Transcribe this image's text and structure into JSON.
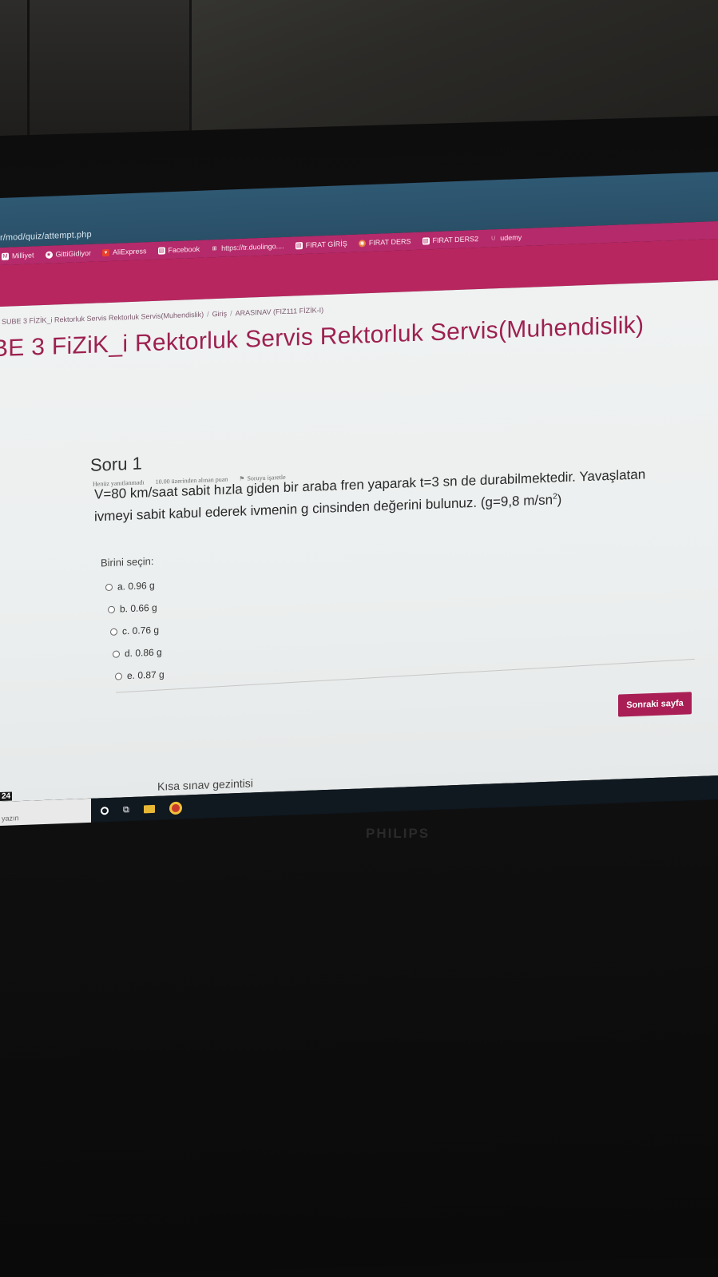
{
  "browser": {
    "url": "r/mod/quiz/attempt.php",
    "bookmarks": [
      {
        "label": "Milliyet",
        "icon": "milliyet-icon"
      },
      {
        "label": "GittiGidiyor",
        "icon": "gittigidiyor-icon"
      },
      {
        "label": "AliExpress",
        "icon": "aliexpress-icon"
      },
      {
        "label": "Facebook",
        "icon": "page-icon"
      },
      {
        "label": "https://tr.duolingo....",
        "icon": "apps-grid-icon"
      },
      {
        "label": "FIRAT GİRİŞ",
        "icon": "page-icon"
      },
      {
        "label": "FIRAT DERS",
        "icon": "globe-icon"
      },
      {
        "label": "FIRAT DERS2",
        "icon": "page-icon"
      },
      {
        "label": "udemy",
        "icon": "udemy-icon"
      }
    ]
  },
  "breadcrumb": {
    "items": [
      "SUBE 3 FİZİK_i Rektorluk Servis Rektorluk Servis(Muhendislik)",
      "Giriş",
      "ARASINAV (FIZ111 FİZİK-I)"
    ],
    "separator": "/"
  },
  "course": {
    "title": "BE 3 FiZiK_i Rektorluk Servis Rektorluk Servis(Muhendislik)"
  },
  "question": {
    "title": "Soru 1",
    "status": "Henüz yanıtlanmadı",
    "points": "10.00 üzerinden alınan puan",
    "flag_label": "Soruyu işaretle",
    "text_line1": "V=80 km/saat sabit hızla giden bir araba fren yaparak t=3 sn de durabilmektedir. Yavaşlatan",
    "text_line2_pre": "ivmeyi sabit kabul ederek ivmenin g cinsinden değerini bulunuz. (g=9,8 m/sn",
    "text_line2_sup": "2",
    "text_line2_post": ")",
    "prompt": "Birini seçin:",
    "answers": [
      "a. 0.96 g",
      "b. 0.66 g",
      "c. 0.76 g",
      "d. 0.86 g",
      "e. 0.87 g"
    ]
  },
  "actions": {
    "next_label": "Sonraki sayfa"
  },
  "quiz_navigation": {
    "label": "Kısa sınav gezintisi"
  },
  "taskbar": {
    "search_text": "yazın",
    "clock_fragment": "24"
  },
  "monitor": {
    "brand": "PHILIPS"
  },
  "colors": {
    "accent": "#a91f55",
    "bookmark_bar": "#b52a6b",
    "title": "#9d2150"
  }
}
